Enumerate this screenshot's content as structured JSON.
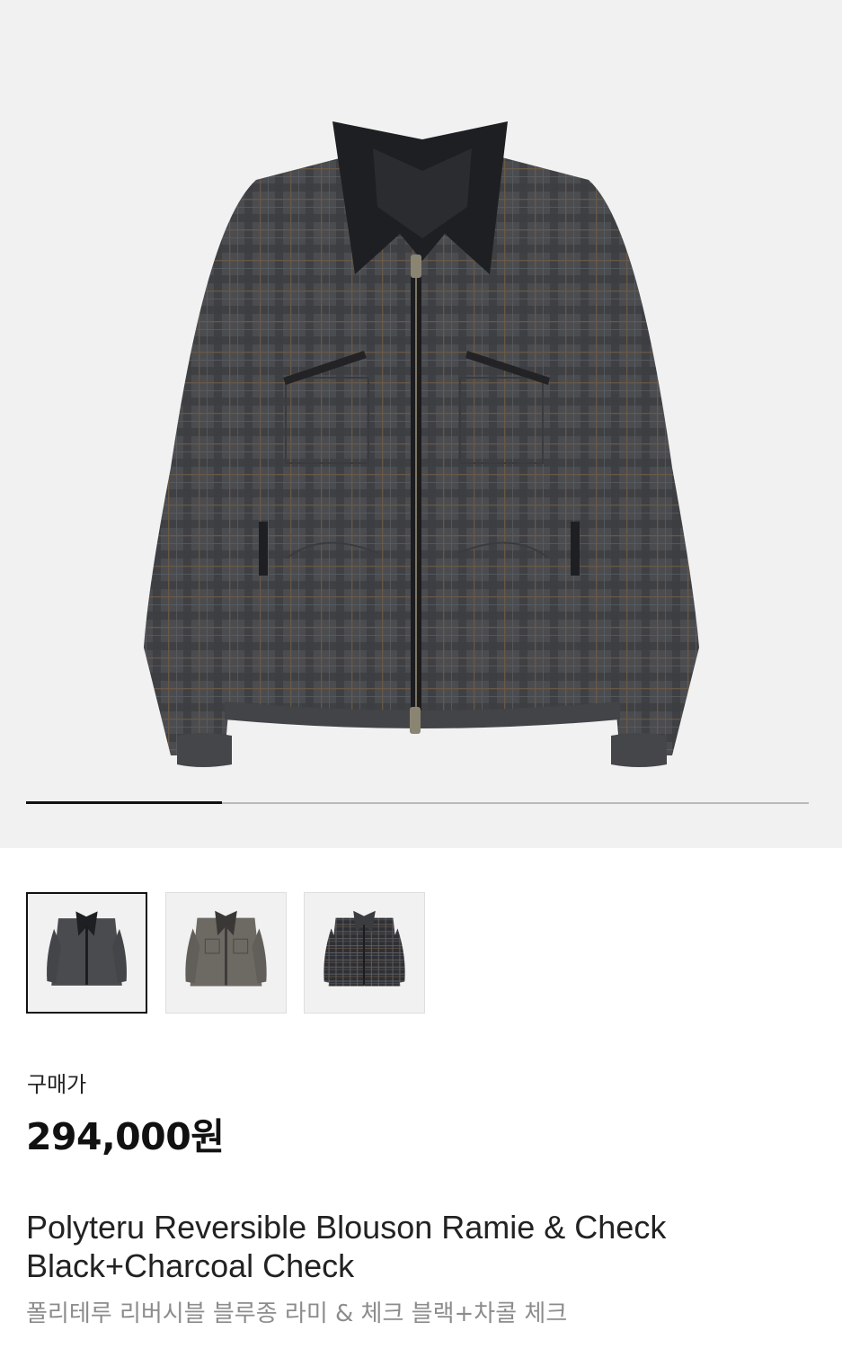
{
  "gallery": {
    "main_image": "charcoal-check-jacket-front",
    "progress_fraction": 0.25,
    "thumbnails": [
      {
        "name": "black-charcoal-check-jacket",
        "selected": true
      },
      {
        "name": "grey-ramie-jacket",
        "selected": false
      },
      {
        "name": "check-jacket-reverse",
        "selected": false
      }
    ]
  },
  "product": {
    "price_label": "구매가",
    "price": "294,000원",
    "title_en_line1": "Polyteru Reversible Blouson Ramie & Check",
    "title_en_line2": "Black+Charcoal Check",
    "title_ko": "폴리테루 리버시블 블루종 라미 & 체크 블랙+차콜 체크"
  },
  "colors": {
    "hero_bg": "#f1f1f1",
    "jacket": "#4a4b4e",
    "collar": "#1e1f22",
    "accent_text": "#111111",
    "subtitle": "#8c8c8c"
  }
}
